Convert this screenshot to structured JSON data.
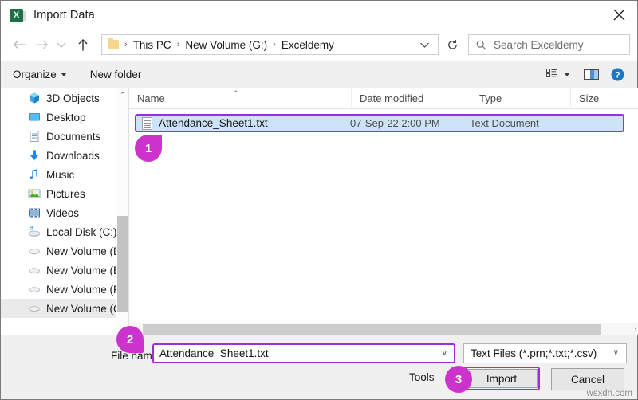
{
  "window": {
    "title": "Import Data",
    "app_icon": "excel-icon",
    "close_label": "✕"
  },
  "nav": {
    "back_icon": "back-arrow-icon",
    "forward_icon": "forward-arrow-icon",
    "recent_icon": "recent-locations-chevron-icon",
    "up_icon": "up-arrow-icon",
    "refresh_icon": "refresh-icon",
    "breadcrumb": [
      "This PC",
      "New Volume (G:)",
      "Exceldemy"
    ],
    "breadcrumb_separator": "›",
    "dropdown_caret": "∨"
  },
  "search": {
    "icon": "search-icon",
    "placeholder": "Search Exceldemy",
    "value": ""
  },
  "toolbar": {
    "organize_label": "Organize",
    "new_folder_label": "New folder",
    "view_icon": "view-layout-icon",
    "pane_icon": "preview-pane-icon",
    "help_icon": "help-icon"
  },
  "sidebar": {
    "items": [
      {
        "label": "3D Objects",
        "icon": "3d-objects-icon",
        "selected": false
      },
      {
        "label": "Desktop",
        "icon": "desktop-icon",
        "selected": false
      },
      {
        "label": "Documents",
        "icon": "documents-icon",
        "selected": false
      },
      {
        "label": "Downloads",
        "icon": "downloads-icon",
        "selected": false
      },
      {
        "label": "Music",
        "icon": "music-icon",
        "selected": false
      },
      {
        "label": "Pictures",
        "icon": "pictures-icon",
        "selected": false
      },
      {
        "label": "Videos",
        "icon": "videos-icon",
        "selected": false
      },
      {
        "label": "Local Disk (C:)",
        "icon": "local-disk-icon",
        "selected": false
      },
      {
        "label": "New Volume (D:)",
        "icon": "drive-icon",
        "selected": false
      },
      {
        "label": "New Volume (E:)",
        "icon": "drive-icon",
        "selected": false
      },
      {
        "label": "New Volume (F:)",
        "icon": "drive-icon",
        "selected": false
      },
      {
        "label": "New Volume (G:)",
        "icon": "drive-icon",
        "selected": true
      }
    ],
    "scroll_up": "⌃",
    "scroll_down": "⌄"
  },
  "filelist": {
    "columns": [
      "Name",
      "Date modified",
      "Type",
      "Size"
    ],
    "sort_indicator": "⌃",
    "rows": [
      {
        "name": "Attendance_Sheet1.txt",
        "date_modified": "07-Sep-22 2:00 PM",
        "type": "Text Document",
        "size": "",
        "icon": "text-document-icon",
        "selected": true
      }
    ],
    "hscroll_left": "‹",
    "hscroll_right": "›"
  },
  "footer": {
    "filename_label": "File name:",
    "filename_value": "Attendance_Sheet1.txt",
    "filename_placeholder": "File name",
    "filetype_value": "Text Files (*.prn;*.txt;*.csv)",
    "tools_label": "Tools",
    "import_label": "Import",
    "cancel_label": "Cancel",
    "caret": "∨"
  },
  "callouts": [
    {
      "number": "1"
    },
    {
      "number": "2"
    },
    {
      "number": "3"
    }
  ],
  "watermark": "wsxdn.com",
  "colors": {
    "accent_purple": "#9b30d9",
    "badge_magenta": "#cc33cc",
    "selection_blue": "#cce4f7",
    "excel_green": "#1e7145"
  }
}
